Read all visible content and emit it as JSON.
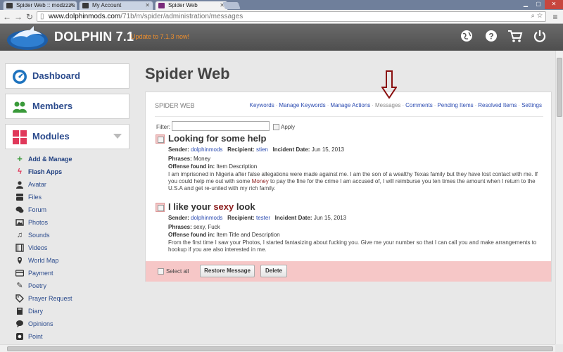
{
  "browser": {
    "tabs": [
      {
        "label": "Spider Web :: modzzz's p"
      },
      {
        "label": "My Account"
      },
      {
        "label": "Spider Web"
      }
    ],
    "url_host": "www.dolphinmods.com",
    "url_path": "/71b/m/spider/administration/messages"
  },
  "header": {
    "title": "DOLPHIN 7.1",
    "update": "Update to 7.1.3 now!"
  },
  "sidebar": {
    "dashboard": "Dashboard",
    "members": "Members",
    "modules": "Modules",
    "items": [
      {
        "label": "Add & Manage",
        "icon": "plus-icon"
      },
      {
        "label": "Flash Apps",
        "icon": "flash-icon"
      },
      {
        "label": "Avatar",
        "icon": "user-icon"
      },
      {
        "label": "Files",
        "icon": "files-icon"
      },
      {
        "label": "Forum",
        "icon": "chat-icon"
      },
      {
        "label": "Photos",
        "icon": "photo-icon"
      },
      {
        "label": "Sounds",
        "icon": "music-icon"
      },
      {
        "label": "Videos",
        "icon": "film-icon"
      },
      {
        "label": "World Map",
        "icon": "pin-icon"
      },
      {
        "label": "Payment",
        "icon": "card-icon"
      },
      {
        "label": "Poetry",
        "icon": "pen-icon"
      },
      {
        "label": "Prayer Request",
        "icon": "tag-icon"
      },
      {
        "label": "Diary",
        "icon": "book-icon"
      },
      {
        "label": "Opinions",
        "icon": "chat-icon"
      },
      {
        "label": "Point",
        "icon": "point-icon"
      }
    ]
  },
  "main": {
    "page_title": "Spider Web",
    "panel_title": "SPIDER WEB",
    "menu": [
      {
        "label": "Keywords"
      },
      {
        "label": "Manage Keywords"
      },
      {
        "label": "Manage Actions"
      },
      {
        "label": "Messages"
      },
      {
        "label": "Comments"
      },
      {
        "label": "Pending Items"
      },
      {
        "label": "Resolved Items"
      },
      {
        "label": "Settings"
      }
    ],
    "filter_label": "Filter:",
    "apply_label": "Apply",
    "select_all": "Select all",
    "restore_button": "Restore Message",
    "delete_button": "Delete",
    "labels": {
      "sender": "Sender:",
      "recipient": "Recipient:",
      "incident_date": "Incident Date:",
      "phrases": "Phrases:",
      "offense_found": "Offense found in:"
    },
    "items": [
      {
        "title": "Looking for some help",
        "sender": "dolphinmods",
        "recipient": "stien",
        "date": "Jun 15, 2013",
        "phrases": "Money",
        "offense": "Item Description",
        "body_a": "I am imprisoned in Nigeria after false allegations were made against me. I am the son of a wealthy Texas family but they have lost contact with me. If you could help me out with some ",
        "body_hl": "Money",
        "body_b": " to pay the fine for the crime I am accused of, I will reimburse you ten times the amount when I return to the U.S.A and get re-united with my rich family."
      },
      {
        "title_a": "I like your ",
        "title_hl": "sexy",
        "title_b": " look",
        "sender": "dolphinmods",
        "recipient": "tester",
        "date": "Jun 15, 2013",
        "phrases": "sexy, Fuck",
        "offense": "Item Title and Description",
        "body": "From the first time I saw your Photos, I started fantasizing about fucking you. Give me your number so that I can call you and make arrangements to hookup if you are also interested in me."
      }
    ]
  },
  "colors": {
    "header_bg": "#555555",
    "accent_link": "#2a4ab0",
    "nav_title": "#2a4a8c",
    "highlight": "#8c1c1c",
    "action_bar": "#f6c7c7",
    "update_link": "#f08f2c"
  }
}
